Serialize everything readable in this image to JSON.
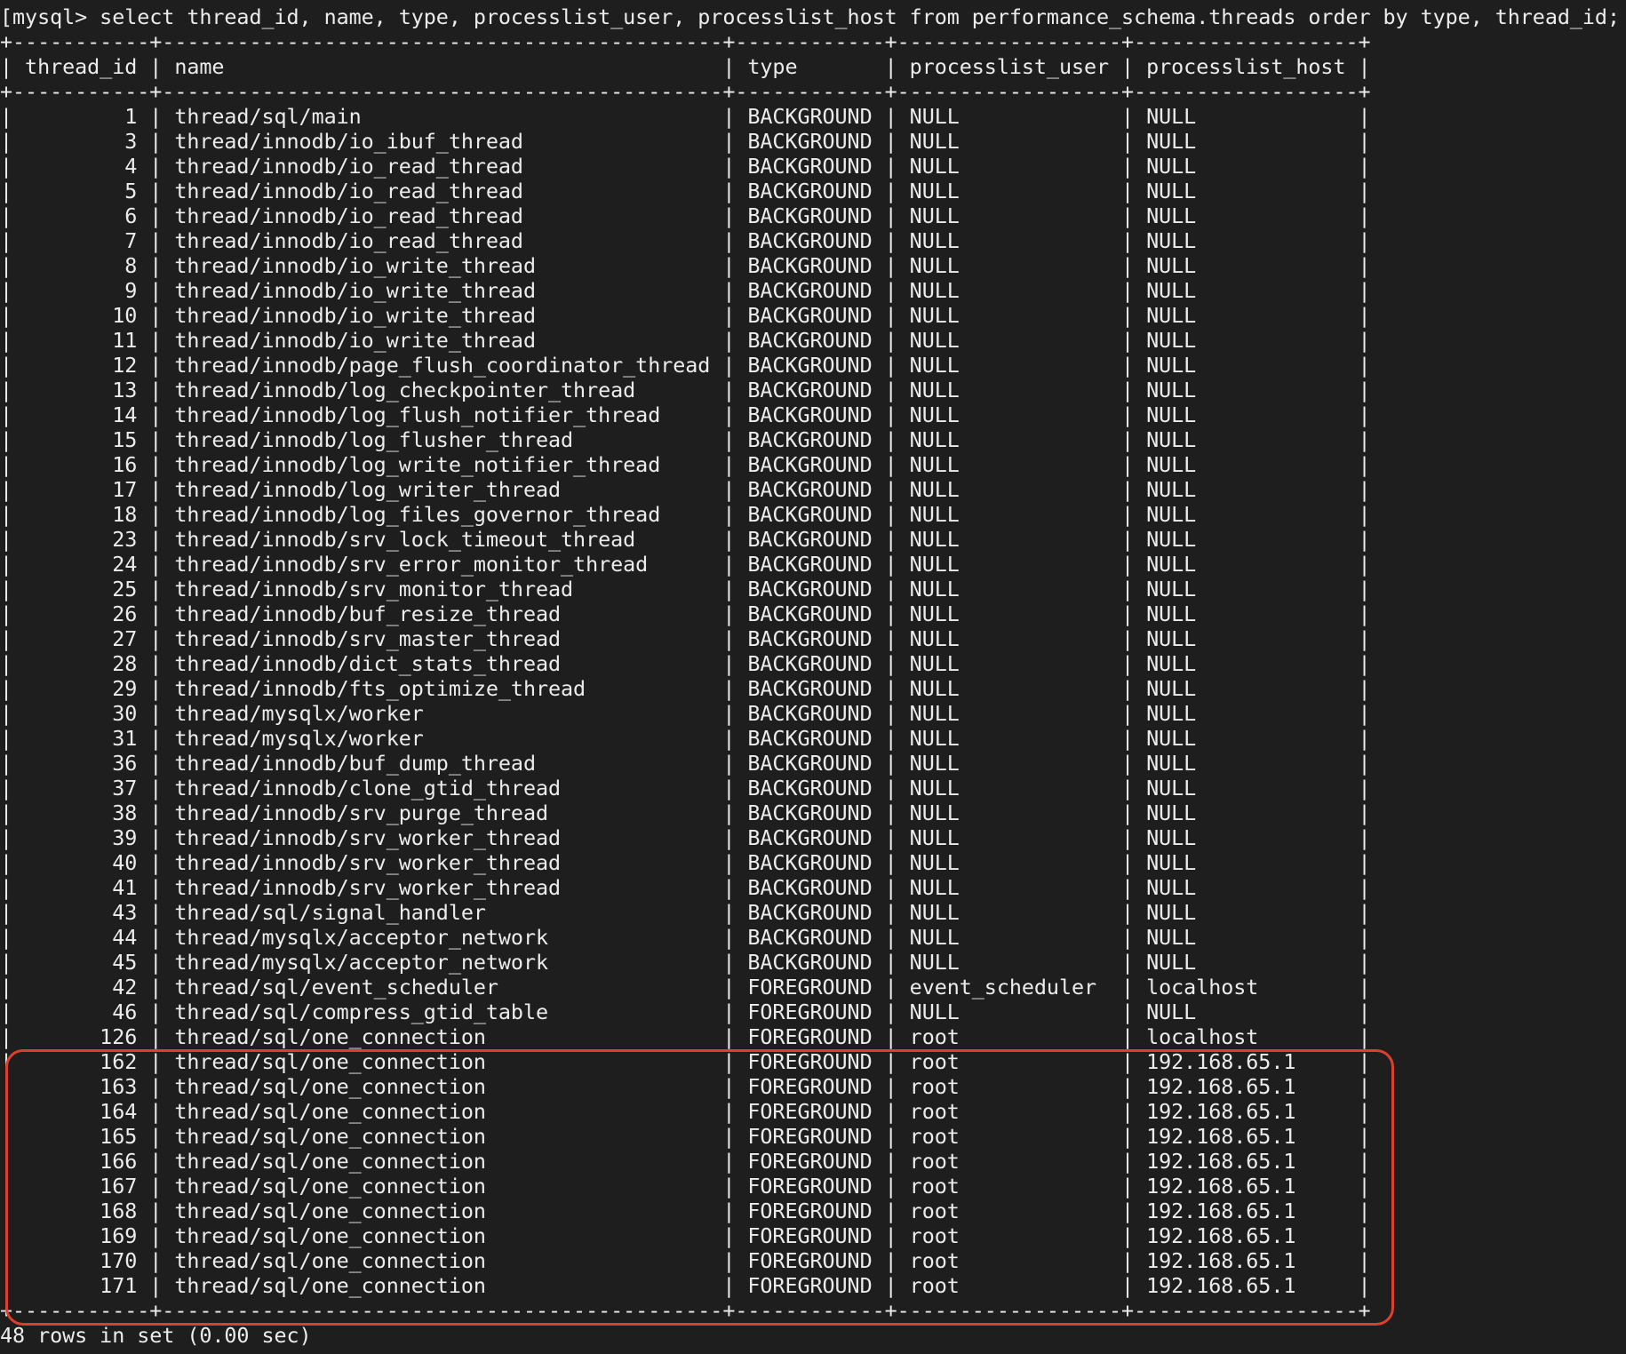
{
  "prompt": "[mysql> ",
  "query": "select thread_id, name, type, processlist_user, processlist_host from performance_schema.threads order by type, thread_id;",
  "table": {
    "columns": [
      "thread_id",
      "name",
      "type",
      "processlist_user",
      "processlist_host"
    ],
    "rows": [
      [
        "1",
        "thread/sql/main",
        "BACKGROUND",
        "NULL",
        "NULL"
      ],
      [
        "3",
        "thread/innodb/io_ibuf_thread",
        "BACKGROUND",
        "NULL",
        "NULL"
      ],
      [
        "4",
        "thread/innodb/io_read_thread",
        "BACKGROUND",
        "NULL",
        "NULL"
      ],
      [
        "5",
        "thread/innodb/io_read_thread",
        "BACKGROUND",
        "NULL",
        "NULL"
      ],
      [
        "6",
        "thread/innodb/io_read_thread",
        "BACKGROUND",
        "NULL",
        "NULL"
      ],
      [
        "7",
        "thread/innodb/io_read_thread",
        "BACKGROUND",
        "NULL",
        "NULL"
      ],
      [
        "8",
        "thread/innodb/io_write_thread",
        "BACKGROUND",
        "NULL",
        "NULL"
      ],
      [
        "9",
        "thread/innodb/io_write_thread",
        "BACKGROUND",
        "NULL",
        "NULL"
      ],
      [
        "10",
        "thread/innodb/io_write_thread",
        "BACKGROUND",
        "NULL",
        "NULL"
      ],
      [
        "11",
        "thread/innodb/io_write_thread",
        "BACKGROUND",
        "NULL",
        "NULL"
      ],
      [
        "12",
        "thread/innodb/page_flush_coordinator_thread",
        "BACKGROUND",
        "NULL",
        "NULL"
      ],
      [
        "13",
        "thread/innodb/log_checkpointer_thread",
        "BACKGROUND",
        "NULL",
        "NULL"
      ],
      [
        "14",
        "thread/innodb/log_flush_notifier_thread",
        "BACKGROUND",
        "NULL",
        "NULL"
      ],
      [
        "15",
        "thread/innodb/log_flusher_thread",
        "BACKGROUND",
        "NULL",
        "NULL"
      ],
      [
        "16",
        "thread/innodb/log_write_notifier_thread",
        "BACKGROUND",
        "NULL",
        "NULL"
      ],
      [
        "17",
        "thread/innodb/log_writer_thread",
        "BACKGROUND",
        "NULL",
        "NULL"
      ],
      [
        "18",
        "thread/innodb/log_files_governor_thread",
        "BACKGROUND",
        "NULL",
        "NULL"
      ],
      [
        "23",
        "thread/innodb/srv_lock_timeout_thread",
        "BACKGROUND",
        "NULL",
        "NULL"
      ],
      [
        "24",
        "thread/innodb/srv_error_monitor_thread",
        "BACKGROUND",
        "NULL",
        "NULL"
      ],
      [
        "25",
        "thread/innodb/srv_monitor_thread",
        "BACKGROUND",
        "NULL",
        "NULL"
      ],
      [
        "26",
        "thread/innodb/buf_resize_thread",
        "BACKGROUND",
        "NULL",
        "NULL"
      ],
      [
        "27",
        "thread/innodb/srv_master_thread",
        "BACKGROUND",
        "NULL",
        "NULL"
      ],
      [
        "28",
        "thread/innodb/dict_stats_thread",
        "BACKGROUND",
        "NULL",
        "NULL"
      ],
      [
        "29",
        "thread/innodb/fts_optimize_thread",
        "BACKGROUND",
        "NULL",
        "NULL"
      ],
      [
        "30",
        "thread/mysqlx/worker",
        "BACKGROUND",
        "NULL",
        "NULL"
      ],
      [
        "31",
        "thread/mysqlx/worker",
        "BACKGROUND",
        "NULL",
        "NULL"
      ],
      [
        "36",
        "thread/innodb/buf_dump_thread",
        "BACKGROUND",
        "NULL",
        "NULL"
      ],
      [
        "37",
        "thread/innodb/clone_gtid_thread",
        "BACKGROUND",
        "NULL",
        "NULL"
      ],
      [
        "38",
        "thread/innodb/srv_purge_thread",
        "BACKGROUND",
        "NULL",
        "NULL"
      ],
      [
        "39",
        "thread/innodb/srv_worker_thread",
        "BACKGROUND",
        "NULL",
        "NULL"
      ],
      [
        "40",
        "thread/innodb/srv_worker_thread",
        "BACKGROUND",
        "NULL",
        "NULL"
      ],
      [
        "41",
        "thread/innodb/srv_worker_thread",
        "BACKGROUND",
        "NULL",
        "NULL"
      ],
      [
        "43",
        "thread/sql/signal_handler",
        "BACKGROUND",
        "NULL",
        "NULL"
      ],
      [
        "44",
        "thread/mysqlx/acceptor_network",
        "BACKGROUND",
        "NULL",
        "NULL"
      ],
      [
        "45",
        "thread/mysqlx/acceptor_network",
        "BACKGROUND",
        "NULL",
        "NULL"
      ],
      [
        "42",
        "thread/sql/event_scheduler",
        "FOREGROUND",
        "event_scheduler",
        "localhost"
      ],
      [
        "46",
        "thread/sql/compress_gtid_table",
        "FOREGROUND",
        "NULL",
        "NULL"
      ],
      [
        "126",
        "thread/sql/one_connection",
        "FOREGROUND",
        "root",
        "localhost"
      ],
      [
        "162",
        "thread/sql/one_connection",
        "FOREGROUND",
        "root",
        "192.168.65.1"
      ],
      [
        "163",
        "thread/sql/one_connection",
        "FOREGROUND",
        "root",
        "192.168.65.1"
      ],
      [
        "164",
        "thread/sql/one_connection",
        "FOREGROUND",
        "root",
        "192.168.65.1"
      ],
      [
        "165",
        "thread/sql/one_connection",
        "FOREGROUND",
        "root",
        "192.168.65.1"
      ],
      [
        "166",
        "thread/sql/one_connection",
        "FOREGROUND",
        "root",
        "192.168.65.1"
      ],
      [
        "167",
        "thread/sql/one_connection",
        "FOREGROUND",
        "root",
        "192.168.65.1"
      ],
      [
        "168",
        "thread/sql/one_connection",
        "FOREGROUND",
        "root",
        "192.168.65.1"
      ],
      [
        "169",
        "thread/sql/one_connection",
        "FOREGROUND",
        "root",
        "192.168.65.1"
      ],
      [
        "170",
        "thread/sql/one_connection",
        "FOREGROUND",
        "root",
        "192.168.65.1"
      ],
      [
        "171",
        "thread/sql/one_connection",
        "FOREGROUND",
        "root",
        "192.168.65.1"
      ]
    ]
  },
  "status_line": "48 rows in set (0.00 sec)",
  "colors": {
    "background": "#1e1e1e",
    "text": "#ececec",
    "highlight": "#d9412e"
  }
}
